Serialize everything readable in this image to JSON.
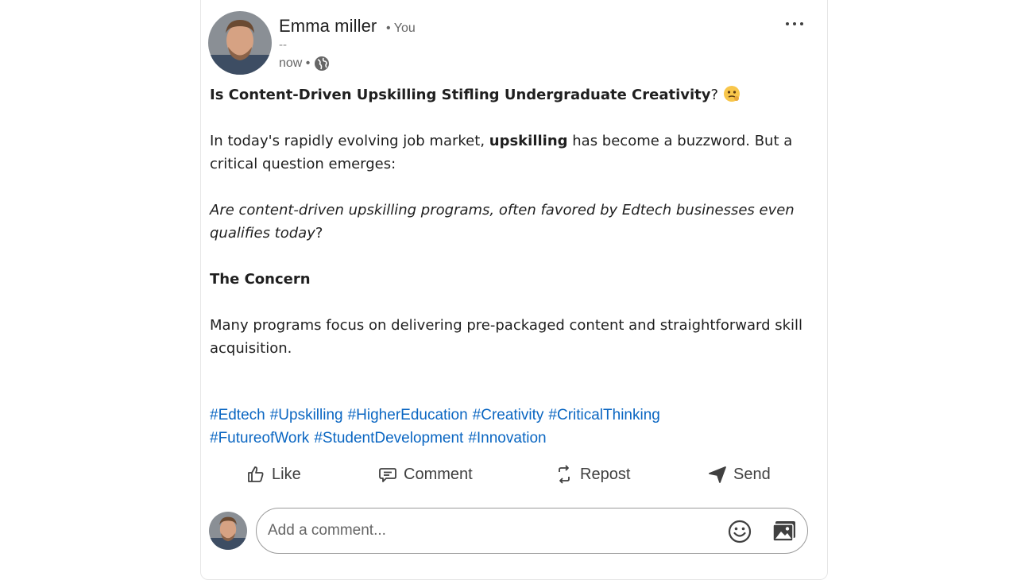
{
  "post": {
    "author": "Emma miller",
    "you_tag": "• You",
    "headline": "--",
    "time": "now •",
    "title_bold": "Is Content-Driven Upskilling Stifling Undergraduate Creativity",
    "title_suffix": "?",
    "para1_a": "In today's rapidly evolving job market, ",
    "para1_bold": "upskilling",
    "para1_b": " has become a buzzword. But a critical question emerges:",
    "para2_italic": "Are content-driven upskilling programs, often favored by Edtech businesses even qualifies today",
    "para2_suffix": "?",
    "section_heading": "The Concern",
    "para3": "Many programs focus on delivering pre-packaged content and straightforward skill acquisition.",
    "hashtags": [
      "#Edtech",
      "#Upskilling",
      "#HigherEducation",
      "#Creativity",
      "#CriticalThinking",
      "#FutureofWork",
      "#StudentDevelopment",
      "#Innovation"
    ]
  },
  "actions": {
    "like": "Like",
    "comment": "Comment",
    "repost": "Repost",
    "send": "Send"
  },
  "comment_box": {
    "placeholder": "Add a comment..."
  },
  "icons": {
    "title_emoji": "thinking-face-icon",
    "visibility": "globe-icon",
    "more": "more-horizontal-icon"
  },
  "colors": {
    "link": "#0a66c2",
    "text": "#1f1f1f",
    "muted": "#666666"
  }
}
